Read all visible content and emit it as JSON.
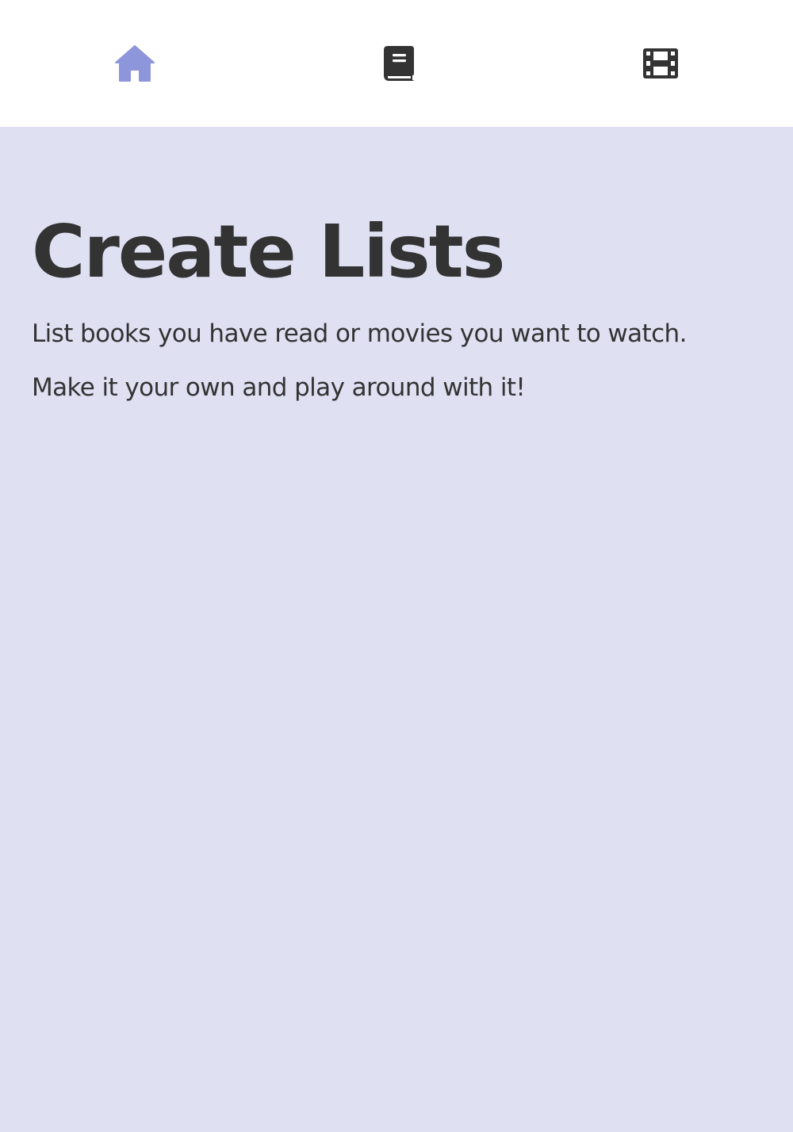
{
  "nav": {
    "items": [
      {
        "icon": "home-icon",
        "active": true,
        "color": "#8e96db"
      },
      {
        "icon": "book-icon",
        "active": false,
        "color": "#333333"
      },
      {
        "icon": "film-icon",
        "active": false,
        "color": "#333333"
      }
    ]
  },
  "hero": {
    "title": "Create Lists",
    "line1": "List books you have read or movies you want to watch.",
    "line2": "Make it your own and play around with it!"
  },
  "colors": {
    "background": "#dfe1f3",
    "nav_background": "#ffffff",
    "text": "#333333",
    "accent": "#8e96db"
  }
}
